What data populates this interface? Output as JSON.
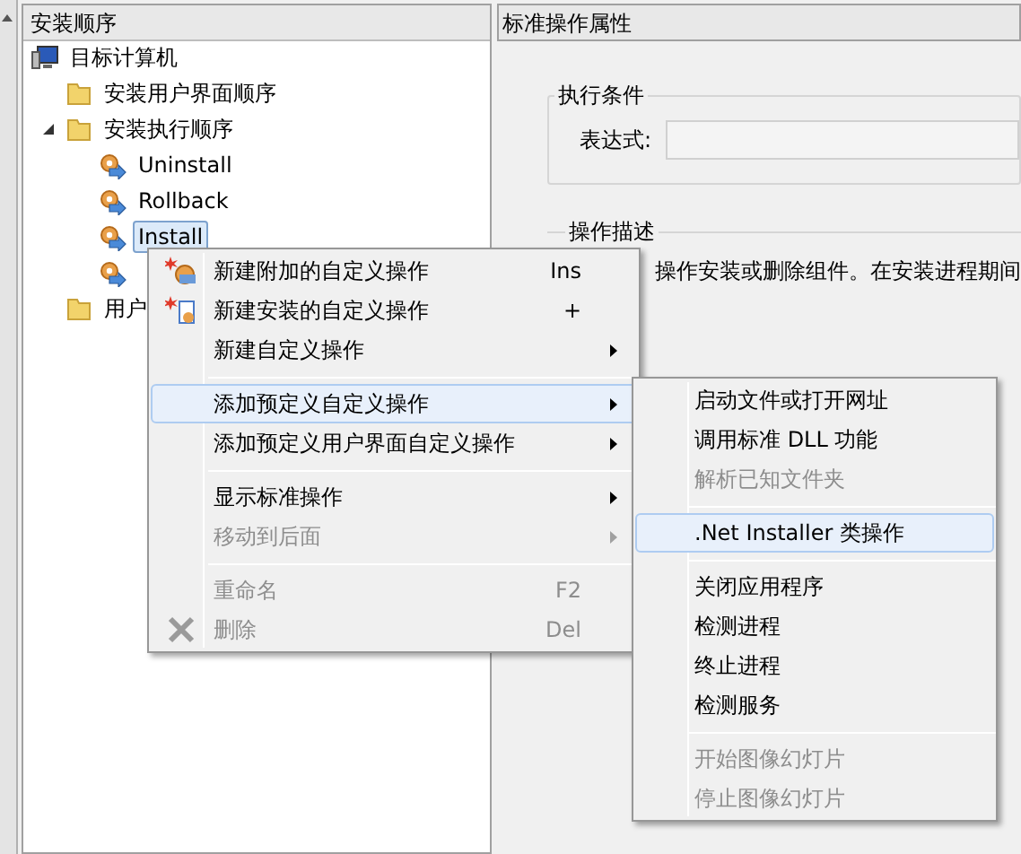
{
  "left_panel": {
    "header": "安装顺序",
    "tree": [
      {
        "label": "目标计算机",
        "kind": "computer",
        "selected": false,
        "children": [
          {
            "label": "安装用户界面顺序",
            "kind": "folder",
            "selected": false
          },
          {
            "label": "安装执行顺序",
            "kind": "folder",
            "selected": false,
            "children": [
              {
                "label": "Uninstall",
                "kind": "action",
                "selected": false
              },
              {
                "label": "Rollback",
                "kind": "action",
                "selected": false
              },
              {
                "label": "Install",
                "kind": "action",
                "selected": true
              },
              {
                "kind": "action"
              }
            ]
          },
          {
            "label": "用户",
            "kind": "folder",
            "selected": false
          }
        ]
      }
    ]
  },
  "right_panel": {
    "header": "标准操作属性",
    "condition_group": {
      "title": "执行条件",
      "expression_label": "表达式:"
    },
    "description_group": {
      "title": "操作描述",
      "text": "操作安装或删除组件。在安装进程期间"
    }
  },
  "context_menu": {
    "items": [
      {
        "kind": "item",
        "label": "新建附加的自定义操作",
        "shortcut": "Ins",
        "submenu": false,
        "disabled": false,
        "selected": false
      },
      {
        "kind": "item",
        "label": "新建安装的自定义操作",
        "shortcut": "+",
        "submenu": false,
        "disabled": false,
        "selected": false
      },
      {
        "kind": "item",
        "label": "新建自定义操作",
        "submenu": true,
        "disabled": false,
        "selected": false
      },
      {
        "kind": "separator"
      },
      {
        "kind": "item",
        "label": "添加预定义自定义操作",
        "submenu": true,
        "disabled": false,
        "selected": true
      },
      {
        "kind": "item",
        "label": "添加预定义用户界面自定义操作",
        "submenu": true,
        "disabled": false,
        "selected": false
      },
      {
        "kind": "separator"
      },
      {
        "kind": "item",
        "label": "显示标准操作",
        "submenu": true,
        "disabled": false,
        "selected": false
      },
      {
        "kind": "item",
        "label": "移动到后面",
        "submenu": true,
        "disabled": true,
        "selected": false
      },
      {
        "kind": "separator"
      },
      {
        "kind": "item",
        "label": "重命名",
        "shortcut": "F2",
        "submenu": false,
        "disabled": true,
        "selected": false
      },
      {
        "kind": "item",
        "label": "删除",
        "shortcut": "Del",
        "submenu": false,
        "disabled": true,
        "selected": false
      }
    ]
  },
  "submenu": {
    "items": [
      {
        "kind": "item",
        "label": "启动文件或打开网址",
        "disabled": false,
        "selected": false
      },
      {
        "kind": "item",
        "label": "调用标准 DLL 功能",
        "disabled": false,
        "selected": false
      },
      {
        "kind": "item",
        "label": "解析已知文件夹",
        "disabled": true,
        "selected": false
      },
      {
        "kind": "separator"
      },
      {
        "kind": "item",
        "label": ".Net Installer 类操作",
        "disabled": false,
        "selected": true
      },
      {
        "kind": "separator"
      },
      {
        "kind": "item",
        "label": "关闭应用程序",
        "disabled": false,
        "selected": false
      },
      {
        "kind": "item",
        "label": "检测进程",
        "disabled": false,
        "selected": false
      },
      {
        "kind": "item",
        "label": "终止进程",
        "disabled": false,
        "selected": false
      },
      {
        "kind": "item",
        "label": "检测服务",
        "disabled": false,
        "selected": false
      },
      {
        "kind": "separator"
      },
      {
        "kind": "item",
        "label": "开始图像幻灯片",
        "disabled": true,
        "selected": false
      },
      {
        "kind": "item",
        "label": "停止图像幻灯片",
        "disabled": true,
        "selected": false
      }
    ]
  }
}
